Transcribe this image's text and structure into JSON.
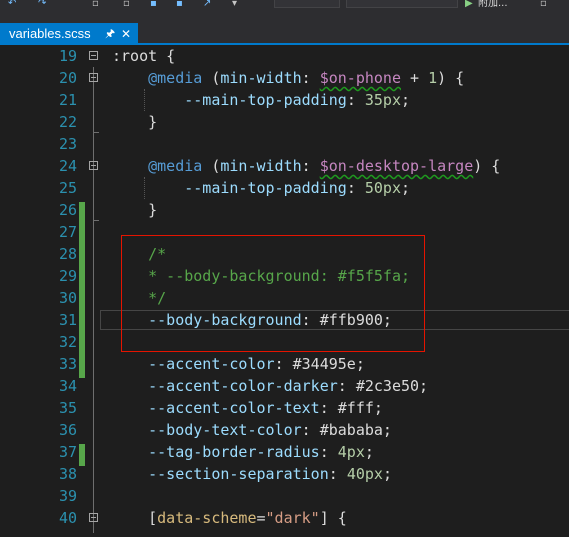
{
  "tab": {
    "filename": "variables.scss",
    "pin": "🖈",
    "close": "✕"
  },
  "toolbar_run_label": "附加...",
  "lines": [
    {
      "num": "19",
      "parts": [
        {
          "t": ":root {",
          "c": ""
        }
      ]
    },
    {
      "num": "20",
      "parts": [
        {
          "t": "    ",
          "c": ""
        },
        {
          "t": "@media",
          "c": "at"
        },
        {
          "t": " (",
          "c": ""
        },
        {
          "t": "min-width",
          "c": "prop"
        },
        {
          "t": ": ",
          "c": ""
        },
        {
          "t": "$on-phone",
          "c": "var sq"
        },
        {
          "t": " + ",
          "c": ""
        },
        {
          "t": "1",
          "c": "num"
        },
        {
          "t": ") {",
          "c": ""
        }
      ]
    },
    {
      "num": "21",
      "parts": [
        {
          "t": "        ",
          "c": ""
        },
        {
          "t": "--main-top-padding",
          "c": "prop"
        },
        {
          "t": ": ",
          "c": ""
        },
        {
          "t": "35px",
          "c": "num"
        },
        {
          "t": ";",
          "c": ""
        }
      ]
    },
    {
      "num": "22",
      "parts": [
        {
          "t": "    }",
          "c": ""
        }
      ]
    },
    {
      "num": "23",
      "parts": []
    },
    {
      "num": "24",
      "parts": [
        {
          "t": "    ",
          "c": ""
        },
        {
          "t": "@media",
          "c": "at"
        },
        {
          "t": " (",
          "c": ""
        },
        {
          "t": "min-width",
          "c": "prop"
        },
        {
          "t": ": ",
          "c": ""
        },
        {
          "t": "$on-desktop-large",
          "c": "var sq"
        },
        {
          "t": ") {",
          "c": ""
        }
      ]
    },
    {
      "num": "25",
      "parts": [
        {
          "t": "        ",
          "c": ""
        },
        {
          "t": "--main-top-padding",
          "c": "prop"
        },
        {
          "t": ": ",
          "c": ""
        },
        {
          "t": "50px",
          "c": "num"
        },
        {
          "t": ";",
          "c": ""
        }
      ]
    },
    {
      "num": "26",
      "parts": [
        {
          "t": "    }",
          "c": ""
        }
      ]
    },
    {
      "num": "27",
      "parts": []
    },
    {
      "num": "28",
      "parts": [
        {
          "t": "    /*",
          "c": "cmt"
        }
      ]
    },
    {
      "num": "29",
      "parts": [
        {
          "t": "    * --body-background: #f5f5fa;",
          "c": "cmt"
        }
      ]
    },
    {
      "num": "30",
      "parts": [
        {
          "t": "    */",
          "c": "cmt"
        }
      ]
    },
    {
      "num": "31",
      "parts": [
        {
          "t": "    ",
          "c": ""
        },
        {
          "t": "--body-background",
          "c": "prop"
        },
        {
          "t": ": #ffb900;",
          "c": ""
        }
      ]
    },
    {
      "num": "32",
      "parts": []
    },
    {
      "num": "33",
      "parts": [
        {
          "t": "    ",
          "c": ""
        },
        {
          "t": "--accent-color",
          "c": "prop"
        },
        {
          "t": ": #34495e;",
          "c": ""
        }
      ]
    },
    {
      "num": "34",
      "parts": [
        {
          "t": "    ",
          "c": ""
        },
        {
          "t": "--accent-color-darker",
          "c": "prop"
        },
        {
          "t": ": #2c3e50;",
          "c": ""
        }
      ]
    },
    {
      "num": "35",
      "parts": [
        {
          "t": "    ",
          "c": ""
        },
        {
          "t": "--accent-color-text",
          "c": "prop"
        },
        {
          "t": ": #fff;",
          "c": ""
        }
      ]
    },
    {
      "num": "36",
      "parts": [
        {
          "t": "    ",
          "c": ""
        },
        {
          "t": "--body-text-color",
          "c": "prop"
        },
        {
          "t": ": #bababa;",
          "c": ""
        }
      ]
    },
    {
      "num": "37",
      "parts": [
        {
          "t": "    ",
          "c": ""
        },
        {
          "t": "--tag-border-radius",
          "c": "prop"
        },
        {
          "t": ": ",
          "c": ""
        },
        {
          "t": "4px",
          "c": "num"
        },
        {
          "t": ";",
          "c": ""
        }
      ]
    },
    {
      "num": "38",
      "parts": [
        {
          "t": "    ",
          "c": ""
        },
        {
          "t": "--section-separation",
          "c": "prop"
        },
        {
          "t": ": ",
          "c": ""
        },
        {
          "t": "40px",
          "c": "num"
        },
        {
          "t": ";",
          "c": ""
        }
      ]
    },
    {
      "num": "39",
      "parts": []
    },
    {
      "num": "40",
      "parts": [
        {
          "t": "    [",
          "c": ""
        },
        {
          "t": "data-scheme",
          "c": "sel"
        },
        {
          "t": "=",
          "c": ""
        },
        {
          "t": "\"dark\"",
          "c": "str"
        },
        {
          "t": "] {",
          "c": ""
        }
      ]
    }
  ]
}
